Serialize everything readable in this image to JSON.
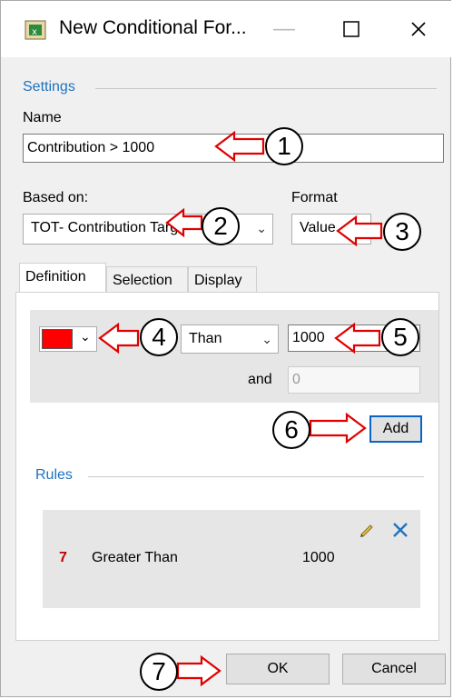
{
  "window": {
    "title": "New Conditional For...",
    "minimize_icon": "minimize-icon",
    "maximize_icon": "maximize-icon",
    "close_icon": "close-icon"
  },
  "settings": {
    "legend": "Settings",
    "name_label": "Name",
    "name_value": "Contribution > 1000",
    "based_on_label": "Based on:",
    "based_on_value": "TOT- Contribution Targ",
    "format_label": "Format",
    "format_value": "Value"
  },
  "tabs": [
    "Definition",
    "Selection",
    "Display"
  ],
  "definition": {
    "color": "#ff0000",
    "operator_value": "Greater Than",
    "operator_visible_text": "Than",
    "value1": "1000",
    "and_label": "and",
    "value2": "0",
    "add_button": "Add"
  },
  "rules": {
    "legend": "Rules",
    "items": [
      {
        "number": "7",
        "name": "Greater Than",
        "value": "1000"
      }
    ]
  },
  "footer": {
    "ok_button": "OK",
    "cancel_button": "Cancel"
  },
  "callouts": [
    "1",
    "2",
    "3",
    "4",
    "5",
    "6",
    "7"
  ],
  "colors": {
    "accent_blue": "#1e73be",
    "rule_number_red": "#c00000",
    "arrow_red": "#e00000"
  }
}
